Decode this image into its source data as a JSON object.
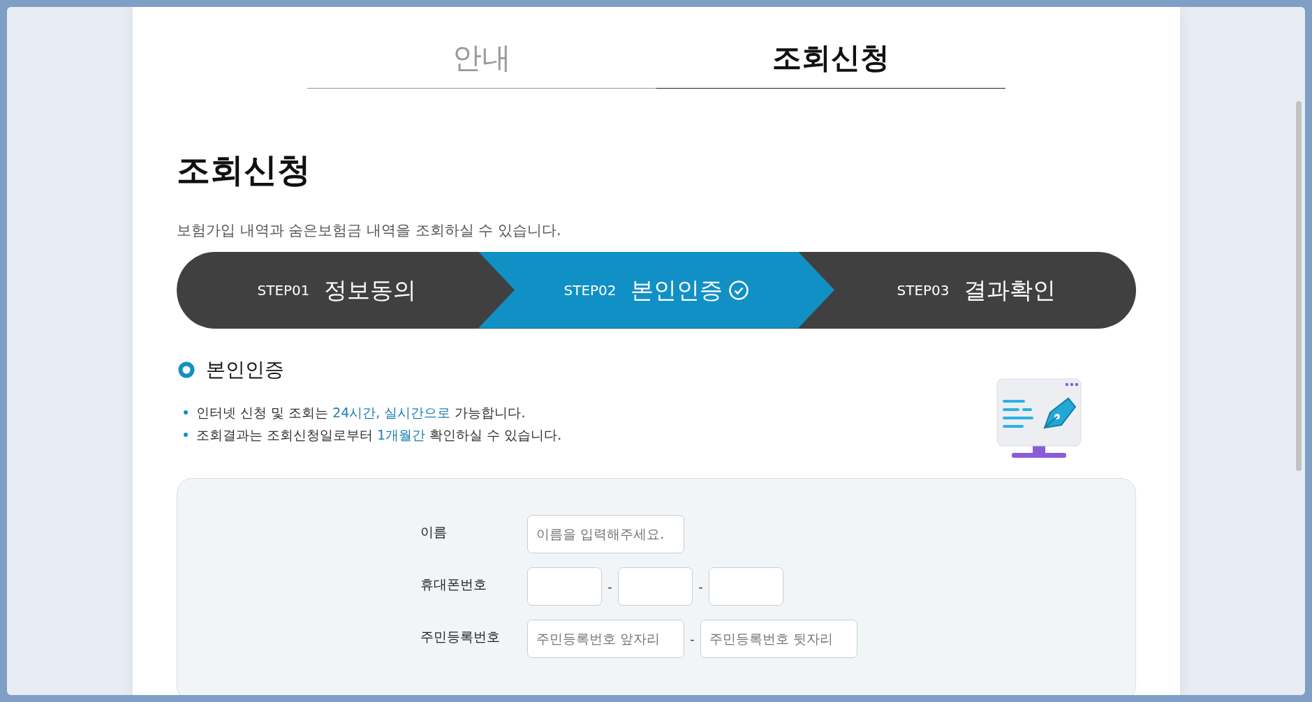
{
  "tabs": [
    {
      "label": "안내",
      "selected": false
    },
    {
      "label": "조회신청",
      "selected": true
    }
  ],
  "title": "조회신청",
  "description": "보험가입 내역과 숨은보험금 내역을 조회하실 수 있습니다.",
  "steps": [
    {
      "number": "STEP01",
      "label": "정보동의",
      "selected": false
    },
    {
      "number": "STEP02",
      "label": "본인인증",
      "selected": true
    },
    {
      "number": "STEP03",
      "label": "결과확인",
      "selected": false
    }
  ],
  "section": {
    "heading": "본인인증",
    "notes": [
      [
        {
          "text": "인터넷 신청 및 조회는 ",
          "highlight": false
        },
        {
          "text": "24시간, 실시간으로",
          "highlight": true
        },
        {
          "text": " 가능합니다.",
          "highlight": false
        }
      ],
      [
        {
          "text": "조회결과는 조회신청일로부터 ",
          "highlight": false
        },
        {
          "text": "1개월간",
          "highlight": true
        },
        {
          "text": " 확인하실 수 있습니다.",
          "highlight": false
        }
      ]
    ]
  },
  "form": [
    {
      "label": "이름",
      "fields": [
        {
          "kind": "input",
          "placeholder": "이름을 입력해주세요."
        }
      ]
    },
    {
      "label": "휴대폰번호",
      "fields": [
        {
          "kind": "input"
        },
        {
          "kind": "separator",
          "text": "-"
        },
        {
          "kind": "input"
        },
        {
          "kind": "separator",
          "text": "-"
        },
        {
          "kind": "input"
        }
      ]
    },
    {
      "label": "주민등록번호",
      "fields": [
        {
          "kind": "input",
          "placeholder": "주민등록번호 앞자리"
        },
        {
          "kind": "separator",
          "text": "-"
        },
        {
          "kind": "input",
          "placeholder": "주민등록번호 뒷자리"
        }
      ]
    }
  ]
}
